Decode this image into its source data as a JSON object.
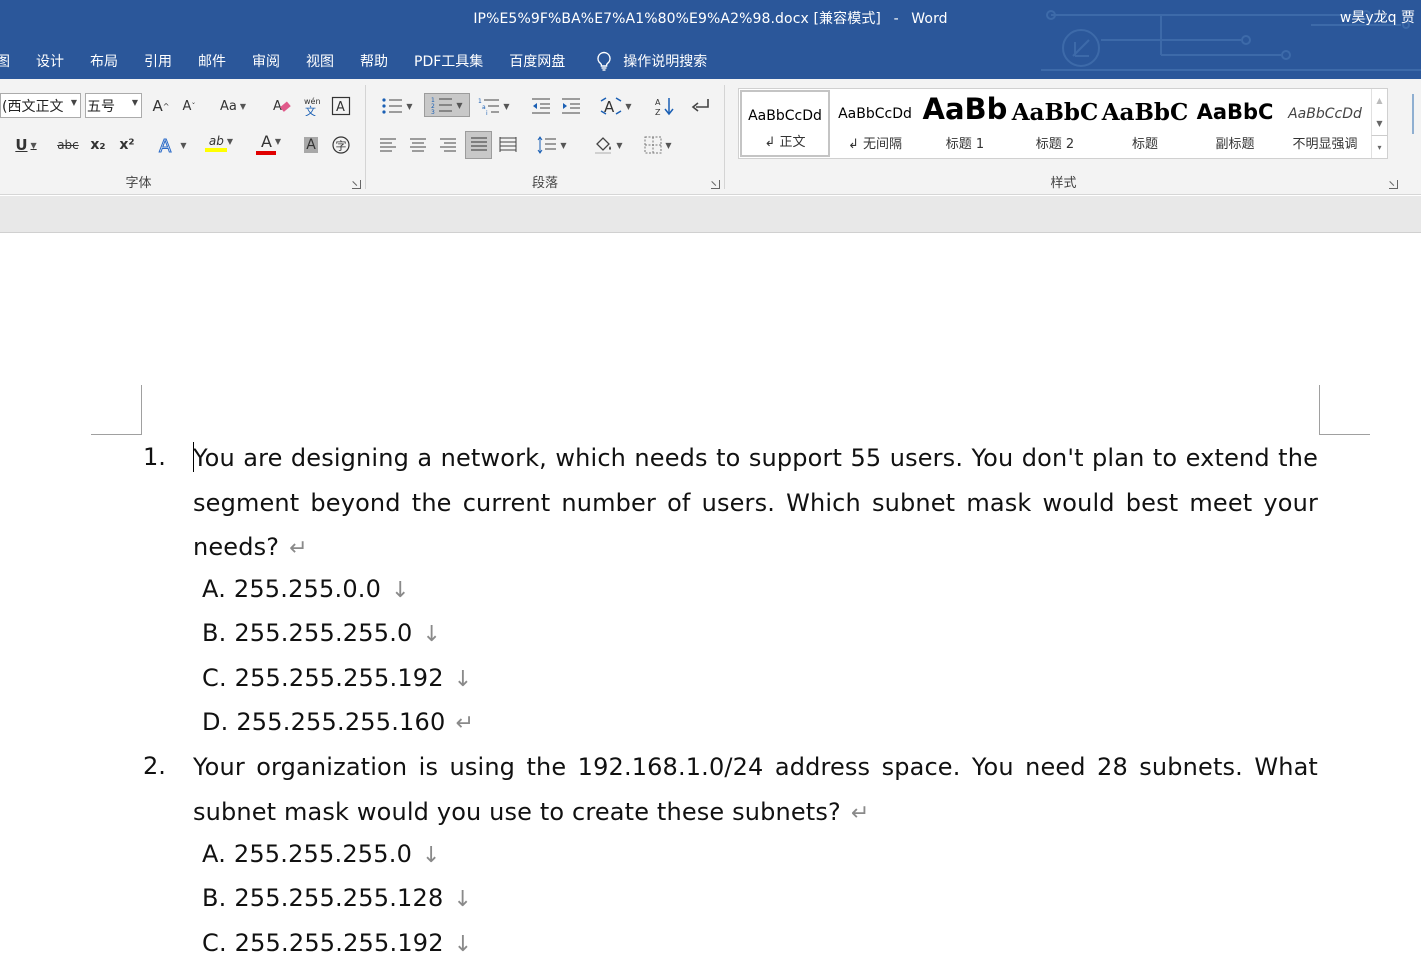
{
  "window": {
    "document_name": "IP%E5%9F%BA%E7%A1%80%E9%A2%98.docx",
    "mode": "[兼容模式]",
    "separator": "-",
    "app_name": "Word",
    "user": "w昊y龙q 贾"
  },
  "menu": {
    "tabs": [
      "图",
      "设计",
      "布局",
      "引用",
      "邮件",
      "审阅",
      "视图",
      "帮助",
      "PDF工具集",
      "百度网盘"
    ],
    "tell_me": "操作说明搜索"
  },
  "ribbon": {
    "font": {
      "label": "字体",
      "font_name": "(西文正文",
      "font_size": "五号",
      "change_case": "Aa",
      "underline": "U",
      "strikethrough": "abc",
      "subscript": "x₂",
      "superscript": "x²",
      "font_color": "A",
      "highlight": "ab"
    },
    "paragraph": {
      "label": "段落"
    },
    "styles": {
      "label": "样式",
      "items": [
        {
          "preview": "AaBbCcDd",
          "name": "↲ 正文"
        },
        {
          "preview": "AaBbCcDd",
          "name": "↲ 无间隔"
        },
        {
          "preview": "AaBb",
          "name": "标题 1"
        },
        {
          "preview": "AaBbC",
          "name": "标题 2"
        },
        {
          "preview": "AaBbC",
          "name": "标题"
        },
        {
          "preview": "AaBbC",
          "name": "副标题"
        },
        {
          "preview": "AaBbCcDd",
          "name": "不明显强调"
        }
      ]
    }
  },
  "colors": {
    "title_bar": "#2b579a",
    "ribbon": "#f3f3f3",
    "font_color_bar": "#e00000",
    "highlight_bar": "#ffff00"
  },
  "document": {
    "questions": [
      {
        "number": "1.",
        "text": "You are designing a network, which needs to support 55 users. You don't plan to extend the segment beyond the current number of users. Which subnet mask would best meet your needs?",
        "end_mark": "↵",
        "options": [
          {
            "text": "A. 255.255.0.0",
            "mark": "↓"
          },
          {
            "text": "B. 255.255.255.0",
            "mark": "↓"
          },
          {
            "text": "C. 255.255.255.192",
            "mark": "↓"
          },
          {
            "text": "D. 255.255.255.160",
            "mark": "↵"
          }
        ]
      },
      {
        "number": "2.",
        "text": "Your organization is using the 192.168.1.0/24 address space. You need 28 subnets. What subnet mask would you use to create these subnets?",
        "end_mark": "↵",
        "options": [
          {
            "text": "A. 255.255.255.0",
            "mark": "↓"
          },
          {
            "text": "B. 255.255.255.128",
            "mark": "↓"
          },
          {
            "text": "C. 255.255.255.192",
            "mark": "↓"
          }
        ]
      }
    ]
  }
}
